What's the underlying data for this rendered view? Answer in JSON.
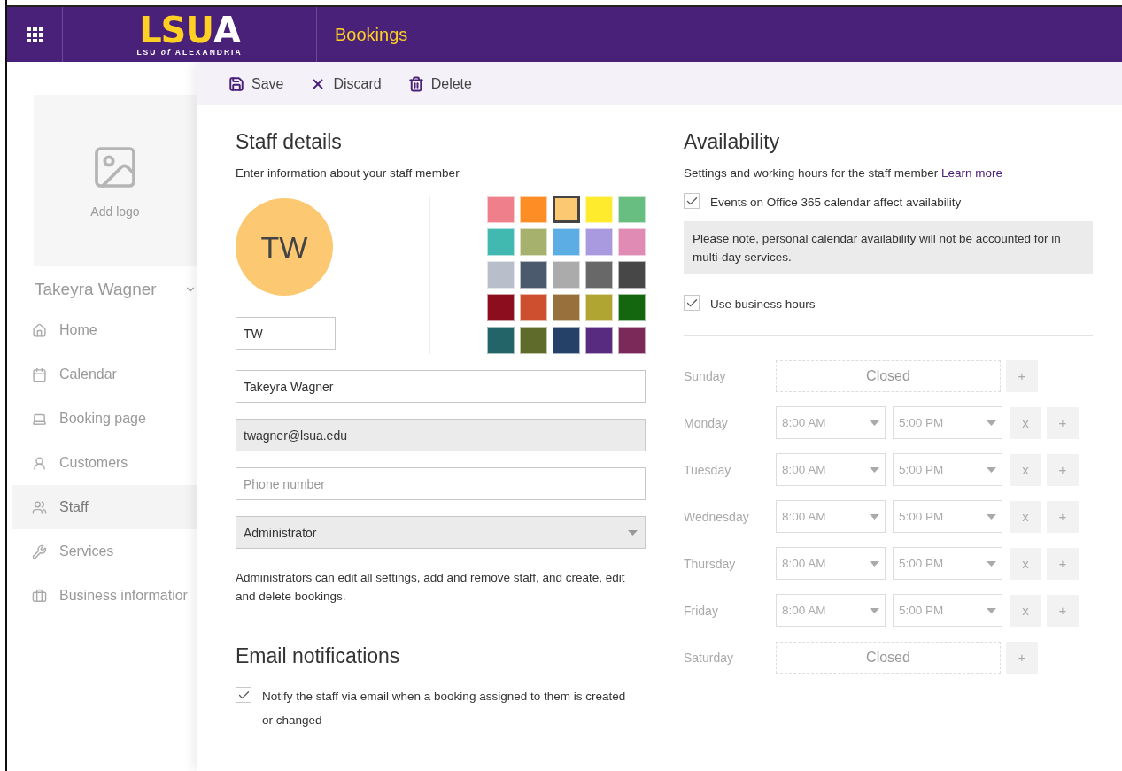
{
  "header": {
    "app_title": "Bookings",
    "logo": {
      "part_a": "LSU",
      "part_b": "A",
      "subtitle": "LSU *of* ALEXANDRIA"
    }
  },
  "toolbar": [
    {
      "kind": "save",
      "label": "Save"
    },
    {
      "kind": "discard",
      "label": "Discard"
    },
    {
      "kind": "delete",
      "label": "Delete"
    }
  ],
  "sidebar": {
    "logo_label": "Add logo",
    "business_name": "Takeyra Wagner",
    "items": [
      {
        "kind": "home",
        "label": "Home",
        "selected": false
      },
      {
        "kind": "calendar",
        "label": "Calendar",
        "selected": false
      },
      {
        "kind": "page",
        "label": "Booking page",
        "selected": false
      },
      {
        "kind": "customers",
        "label": "Customers",
        "selected": false
      },
      {
        "kind": "staff",
        "label": "Staff",
        "selected": true
      },
      {
        "kind": "services",
        "label": "Services",
        "selected": false
      },
      {
        "kind": "business",
        "label": "Business informatior",
        "selected": false
      }
    ]
  },
  "staff_details": {
    "title": "Staff details",
    "subtitle": "Enter information about your staff member",
    "initials": "TW",
    "initials_value": "TW",
    "colors": [
      {
        "color": "#ef7f8a",
        "selected": false
      },
      {
        "color": "#fd8d24",
        "selected": false
      },
      {
        "color": "#fcc872",
        "selected": true
      },
      {
        "color": "#ffeb2d",
        "selected": false
      },
      {
        "color": "#68bd80",
        "selected": false
      },
      {
        "color": "#41b9b0",
        "selected": false
      },
      {
        "color": "#a6b16d",
        "selected": false
      },
      {
        "color": "#5cade3",
        "selected": false
      },
      {
        "color": "#a99ae0",
        "selected": false
      },
      {
        "color": "#e08bb3",
        "selected": false
      },
      {
        "color": "#b9bfca",
        "selected": false
      },
      {
        "color": "#4c5a6e",
        "selected": false
      },
      {
        "color": "#ababab",
        "selected": false
      },
      {
        "color": "#686868",
        "selected": false
      },
      {
        "color": "#474747",
        "selected": false
      },
      {
        "color": "#8b0d1e",
        "selected": false
      },
      {
        "color": "#cd4f30",
        "selected": false
      },
      {
        "color": "#97703b",
        "selected": false
      },
      {
        "color": "#b0a532",
        "selected": false
      },
      {
        "color": "#14660f",
        "selected": false
      },
      {
        "color": "#236468",
        "selected": false
      },
      {
        "color": "#5f6b2a",
        "selected": false
      },
      {
        "color": "#254167",
        "selected": false
      },
      {
        "color": "#582b80",
        "selected": false
      },
      {
        "color": "#7b2959",
        "selected": false
      }
    ],
    "name": "Takeyra Wagner",
    "email": "twagner@lsua.edu",
    "phone_placeholder": "Phone number",
    "role": "Administrator",
    "role_note": "Administrators can edit all settings, add and remove staff, and create, edit and delete bookings."
  },
  "email_notifications": {
    "title": "Email notifications",
    "option": {
      "label": "Notify the staff via email when a booking assigned to them is created or changed",
      "checked": true
    }
  },
  "availability": {
    "title": "Availability",
    "subtitle": "Settings and working hours for the staff member",
    "learn_more": "Learn more",
    "calendar_option": {
      "label": "Events on Office 365 calendar affect availability",
      "checked": true
    },
    "note": "Please note, personal calendar availability will not be accounted for in multi-day services.",
    "business_hours_option": {
      "label": "Use business hours",
      "checked": true
    },
    "days": [
      {
        "day": "Sunday",
        "kind": "closed",
        "label": "Closed",
        "add": "+"
      },
      {
        "day": "Monday",
        "kind": "hours",
        "start": "8:00 AM",
        "end": "5:00 PM",
        "remove": "x",
        "add": "+"
      },
      {
        "day": "Tuesday",
        "kind": "hours",
        "start": "8:00 AM",
        "end": "5:00 PM",
        "remove": "x",
        "add": "+"
      },
      {
        "day": "Wednesday",
        "kind": "hours",
        "start": "8:00 AM",
        "end": "5:00 PM",
        "remove": "x",
        "add": "+"
      },
      {
        "day": "Thursday",
        "kind": "hours",
        "start": "8:00 AM",
        "end": "5:00 PM",
        "remove": "x",
        "add": "+"
      },
      {
        "day": "Friday",
        "kind": "hours",
        "start": "8:00 AM",
        "end": "5:00 PM",
        "remove": "x",
        "add": "+"
      },
      {
        "day": "Saturday",
        "kind": "closed",
        "label": "Closed",
        "add": "+"
      }
    ]
  }
}
